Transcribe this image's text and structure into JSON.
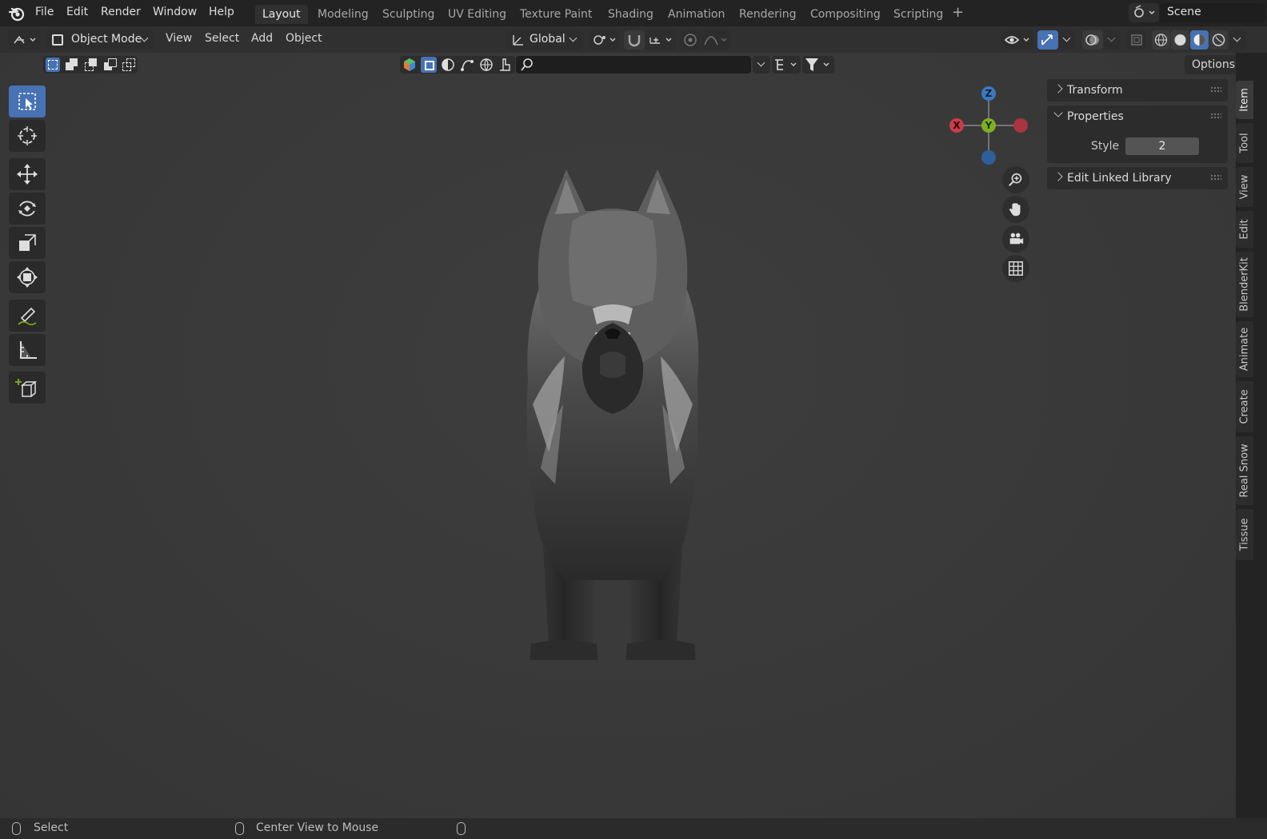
{
  "menubar": {
    "items": [
      "File",
      "Edit",
      "Render",
      "Window",
      "Help"
    ]
  },
  "workspaces": {
    "tabs": [
      "Layout",
      "Modeling",
      "Sculpting",
      "UV Editing",
      "Texture Paint",
      "Shading",
      "Animation",
      "Rendering",
      "Compositing",
      "Scripting"
    ],
    "active": "Layout"
  },
  "scene": {
    "name": "Scene"
  },
  "header": {
    "mode": "Object Mode",
    "menus": [
      "View",
      "Select",
      "Add",
      "Object"
    ],
    "orientation": "Global",
    "options_label": "Options"
  },
  "gizmo": {
    "x": "X",
    "y": "Y",
    "z": "Z"
  },
  "sidebar": {
    "panels": {
      "transform": "Transform",
      "properties": "Properties",
      "style_label": "Style",
      "style_value": "2",
      "edit_linked": "Edit Linked Library"
    },
    "tabs": [
      "Item",
      "Tool",
      "View",
      "Edit",
      "BlenderKit",
      "Animate",
      "Create",
      "Real Snow",
      "Tissue"
    ],
    "active_tab": "Item"
  },
  "statusbar": {
    "select": "Select",
    "center_view": "Center View to Mouse"
  },
  "colors": {
    "accent": "#4772b3",
    "axis_x": "#c93d4a",
    "axis_y": "#7fb11e",
    "axis_z": "#3a78c4"
  }
}
